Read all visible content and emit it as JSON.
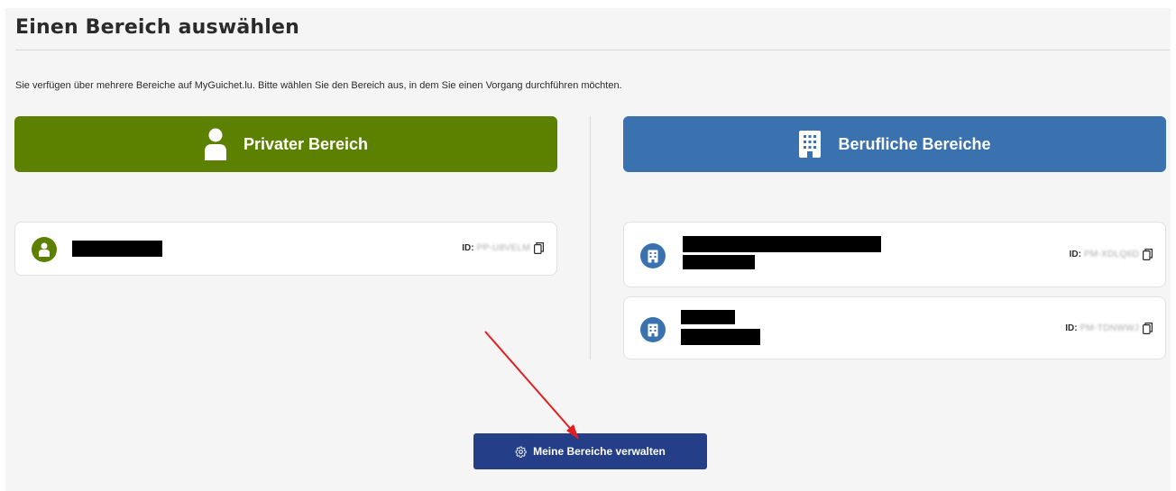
{
  "page": {
    "title": "Einen Bereich auswählen",
    "intro": "Sie verfügen über mehrere Bereiche auf MyGuichet.lu. Bitte wählen Sie den Bereich aus, in dem Sie einen Vorgang durchführen möchten."
  },
  "private": {
    "header_label": "Privater Bereich",
    "icon": "person-icon",
    "color": "#5c8100",
    "spaces": [
      {
        "id_label": "ID:",
        "id_value": "PP-U8VELM",
        "icon": "user-icon",
        "name": "[redacted]"
      }
    ]
  },
  "professional": {
    "header_label": "Berufliche Bereiche",
    "icon": "building-icon",
    "color": "#3a72b0",
    "spaces": [
      {
        "id_label": "ID:",
        "id_value": "PM-XDLQ6D",
        "icon": "building-icon",
        "name": "[redacted]"
      },
      {
        "id_label": "ID:",
        "id_value": "PM-TDNWWJ",
        "icon": "building-icon",
        "name": "[redacted]"
      }
    ]
  },
  "actions": {
    "manage_label": "Meine Bereiche verwalten",
    "manage_icon": "gear-icon",
    "button_color": "#243f87"
  },
  "annotation": {
    "arrow_color": "#e02020"
  }
}
